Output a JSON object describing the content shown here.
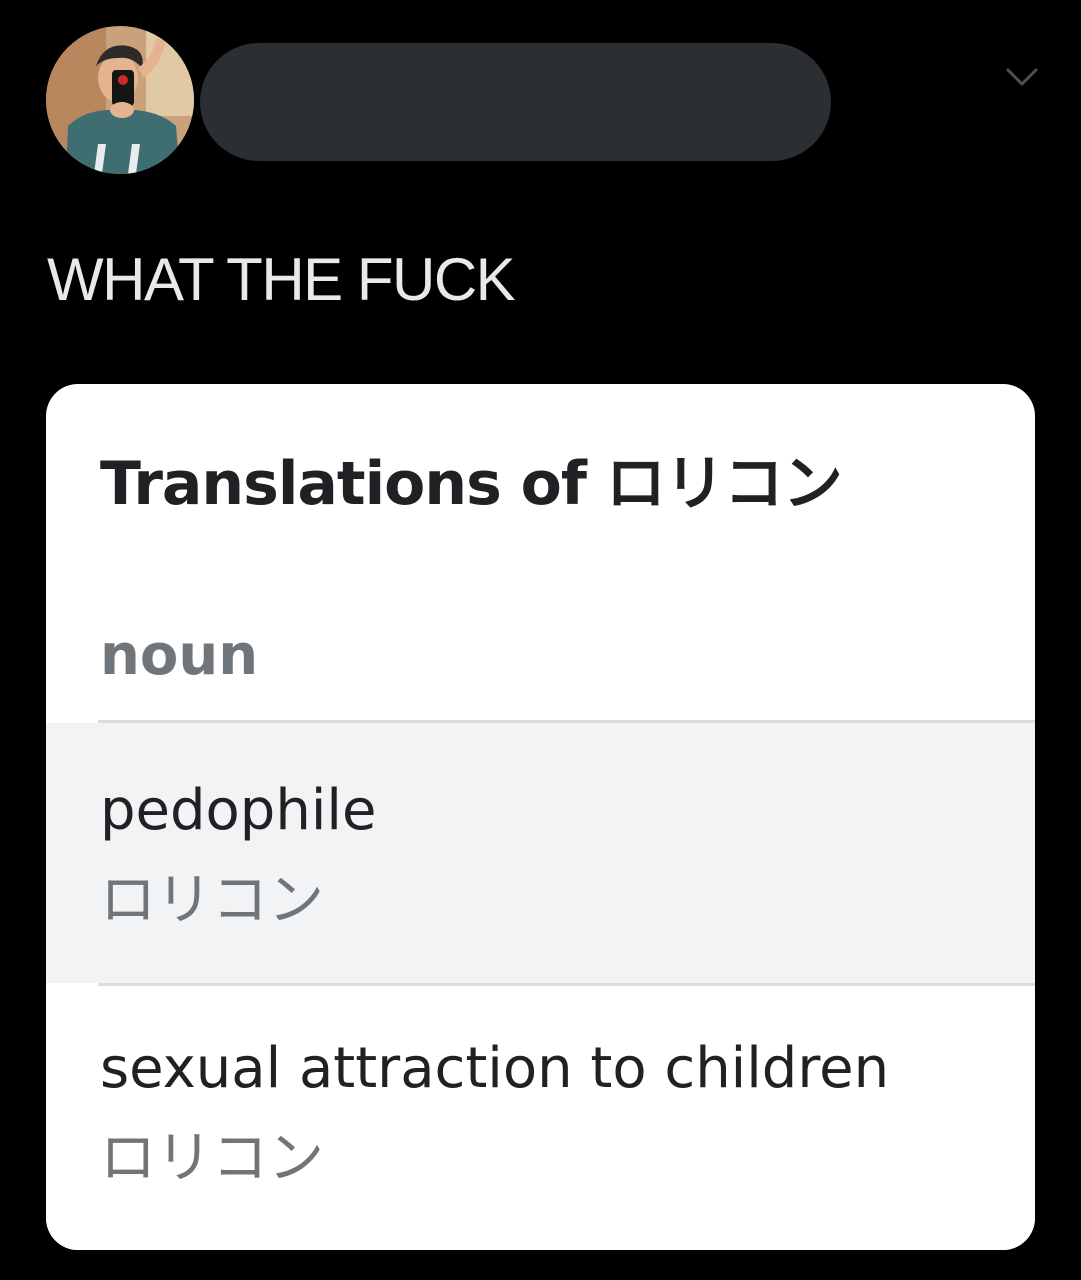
{
  "tweet": {
    "text": "WHAT THE FUCK"
  },
  "card": {
    "title": "Translations of ロリコン",
    "part_of_speech": "noun",
    "translations": [
      {
        "word": "pedophile",
        "reverse": "ロリコン"
      },
      {
        "word": "sexual attraction to children",
        "reverse": "ロリコン"
      }
    ]
  },
  "icons": {
    "avatar": "profile-photo",
    "menu": "chevron-down-icon"
  },
  "colors": {
    "background": "#000000",
    "tweet_text": "#e7e9ea",
    "redaction": "#2b2e33",
    "card_background": "#ffffff",
    "highlight_row": "#f1f3f4",
    "primary_text": "#202124",
    "secondary_text": "#70757a",
    "divider": "#dadce0"
  }
}
